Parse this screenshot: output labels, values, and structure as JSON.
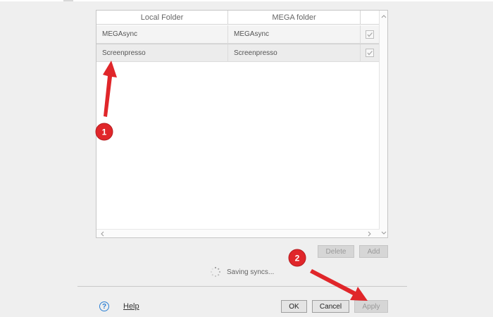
{
  "table": {
    "columns": {
      "local": "Local Folder",
      "mega": "MEGA folder"
    },
    "rows": [
      {
        "local": "MEGAsync",
        "mega": "MEGAsync",
        "checked": true
      },
      {
        "local": "Screenpresso",
        "mega": "Screenpresso",
        "checked": true
      }
    ]
  },
  "actions": {
    "delete": "Delete",
    "add": "Add"
  },
  "status": {
    "text": "Saving syncs..."
  },
  "footer": {
    "help": "Help",
    "ok": "OK",
    "cancel": "Cancel",
    "apply": "Apply"
  },
  "annotations": {
    "step1": "1",
    "step2": "2"
  },
  "colors": {
    "annotation_red": "#e0262a",
    "link_blue": "#2a7fd4"
  }
}
